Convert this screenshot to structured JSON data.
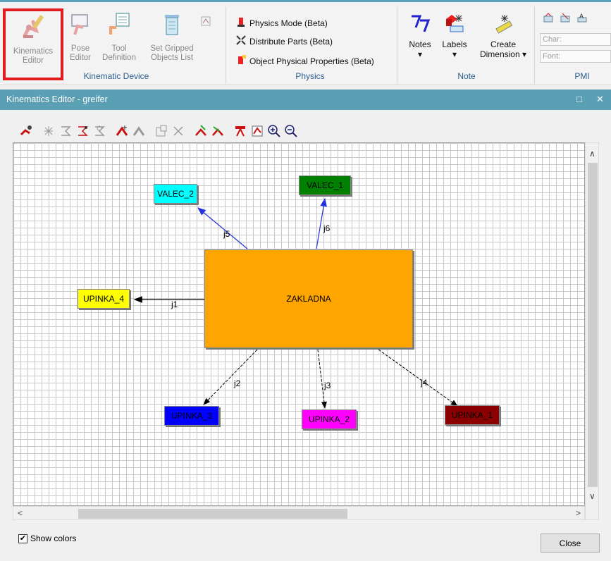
{
  "ribbon": {
    "kinematic_device": {
      "group_label": "Kinematic Device",
      "buttons": [
        {
          "line1": "Kinematics",
          "line2": "Editor",
          "icon": "kinematics-editor-icon"
        },
        {
          "line1": "Pose",
          "line2": "Editor",
          "icon": "pose-editor-icon"
        },
        {
          "line1": "Tool",
          "line2": "Definition",
          "icon": "tool-definition-icon"
        },
        {
          "line1": "Set Gripped",
          "line2": "Objects List",
          "icon": "set-gripped-icon"
        }
      ]
    },
    "physics": {
      "group_label": "Physics",
      "items": [
        "Physics Mode (Beta)",
        "Distribute Parts (Beta)",
        "Object Physical Properties (Beta)"
      ]
    },
    "note": {
      "group_label": "Note",
      "notes": "Notes",
      "labels": "Labels",
      "create_dimension_1": "Create",
      "create_dimension_2": "Dimension ▾"
    },
    "pmi": {
      "group_label": "PMI",
      "char_placeholder": "Char:",
      "font_placeholder": "Font:"
    }
  },
  "window": {
    "title": "Kinematics Editor -  greifer",
    "maximize": "□",
    "close": "✕"
  },
  "graph": {
    "nodes": {
      "zakladna": "ZAKLADNA",
      "valec2": "VALEC_2",
      "valec1": "VALEC_1",
      "upinka4": "UPINKA_4",
      "upinka3": "UPINKA_3",
      "upinka2": "UPINKA_2",
      "upinka1": "UPINKA_1"
    },
    "joints": {
      "j1": "j1",
      "j2": "j2",
      "j3": "j3",
      "j4": "j4",
      "j5": "j5",
      "j6": "j6"
    },
    "colors": {
      "zakladna": "#ffa500",
      "valec2": "#00ffff",
      "valec1": "#008000",
      "upinka4": "#ffff00",
      "upinka3": "#0000ff",
      "upinka2": "#ff00ff",
      "upinka1": "#8b0000"
    }
  },
  "footer": {
    "show_colors": "Show colors",
    "show_colors_checked": true,
    "close": "Close"
  }
}
